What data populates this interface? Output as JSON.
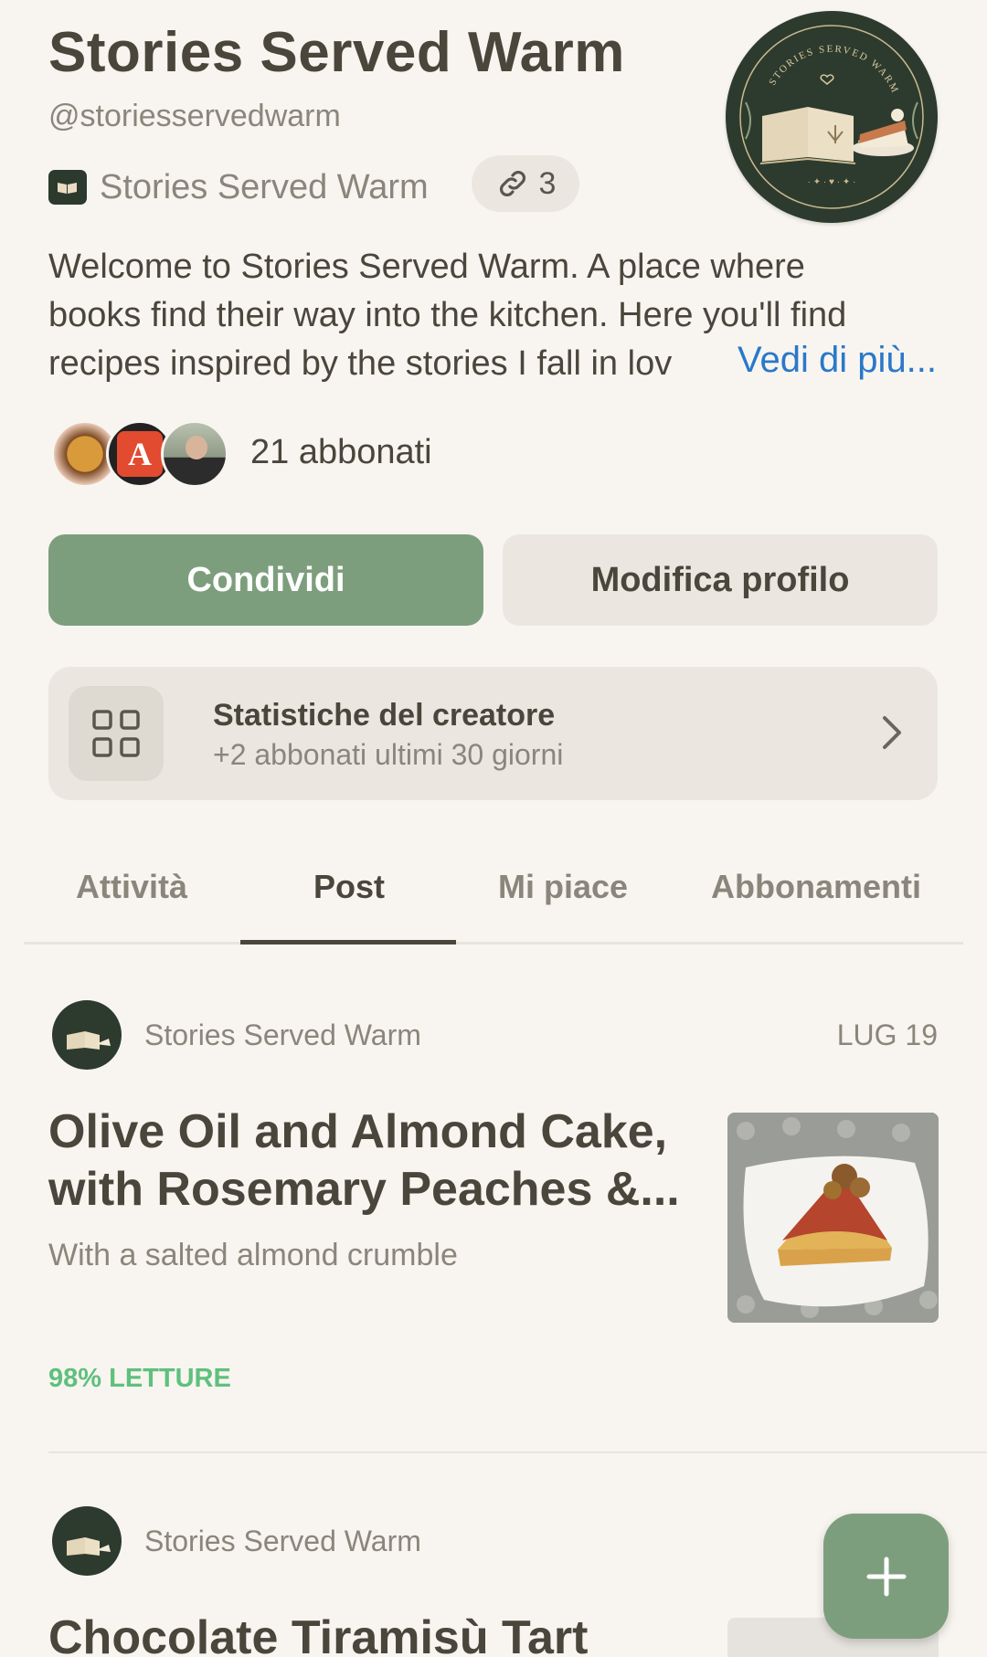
{
  "profile": {
    "name": "Stories Served Warm",
    "handle": "@storiesservedwarm",
    "publication": "Stories Served Warm",
    "links_count": "3",
    "bio_lines": [
      "Welcome to Stories Served Warm. A place where",
      "books find their way into the kitchen. Here you'll find",
      "recipes inspired by the stories I fall in lov"
    ],
    "see_more": "Vedi di più...",
    "subscribers": "21 abbonati",
    "avatar_icon": "book-and-cake-logo-icon",
    "logo_ring_text": "STORIES SERVED WARM"
  },
  "actions": {
    "share_label": "Condividi",
    "edit_label": "Modifica profilo"
  },
  "stats": {
    "title": "Statistiche del creatore",
    "subtitle": "+2 abbonati ultimi 30 giorni"
  },
  "tabs": [
    {
      "label": "Attività",
      "active": false
    },
    {
      "label": "Post",
      "active": true
    },
    {
      "label": "Mi piace",
      "active": false
    },
    {
      "label": "Abbonamenti",
      "active": false
    }
  ],
  "posts": [
    {
      "author": "Stories Served Warm",
      "date": "LUG 19",
      "title_line1": "Olive Oil and Almond Cake,",
      "title_line2": "with Rosemary Peaches &...",
      "subtitle": "With a salted almond crumble",
      "reads": "98% LETTURE"
    },
    {
      "author": "Stories Served Warm",
      "title_line1": "Chocolate Tiramisù Tart"
    }
  ],
  "colors": {
    "background": "#f8f5f0",
    "accent_green": "#7d9e7d",
    "link_blue": "#2a78c9",
    "reads_green": "#5fc07d",
    "logo_dark_green": "#2d3b2e"
  }
}
